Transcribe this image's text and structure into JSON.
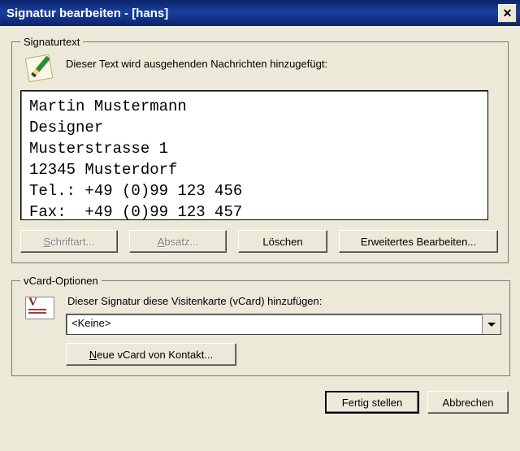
{
  "window": {
    "title": "Signatur bearbeiten - [hans]"
  },
  "signature_group": {
    "legend": "Signaturtext",
    "description": "Dieser Text wird ausgehenden Nachrichten hinzugefügt:",
    "content": "Martin Mustermann\nDesigner\nMusterstrasse 1\n12345 Musterdorf\nTel.: +49 (0)99 123 456\nFax:  +49 (0)99 123 457",
    "buttons": {
      "font": "Schriftart...",
      "paragraph": "Absatz...",
      "clear": "Löschen",
      "advanced": "Erweitertes Bearbeiten..."
    }
  },
  "vcard_group": {
    "legend": "vCard-Optionen",
    "description": "Dieser Signatur diese Visitenkarte (vCard) hinzufügen:",
    "selected": "<Keine>",
    "new_button": "Neue vCard von Kontakt..."
  },
  "footer": {
    "finish": "Fertig stellen",
    "cancel": "Abbrechen"
  }
}
